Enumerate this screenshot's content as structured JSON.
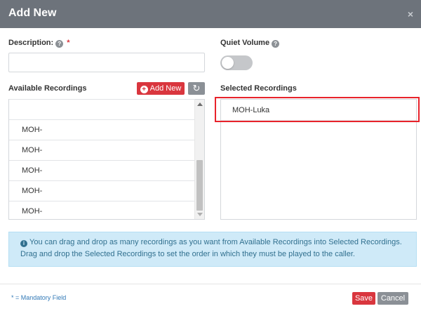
{
  "modal": {
    "title": "Add New",
    "close_glyph": "×"
  },
  "form": {
    "description_label": "Description:",
    "description_value": "",
    "quiet_volume_label": "Quiet Volume",
    "quiet_volume_on": false,
    "required_marker": "*",
    "help_glyph": "?"
  },
  "available": {
    "label": "Available Recordings",
    "add_new_label": "Add New",
    "refresh_glyph": "↻",
    "items": [
      "",
      "MOH-",
      "MOH-",
      "MOH-",
      "MOH-",
      "MOH-"
    ]
  },
  "selected": {
    "label": "Selected Recordings",
    "items": [
      "MOH-Luka"
    ]
  },
  "info": {
    "icon_glyph": "i",
    "text": "You can drag and drop as many recordings as you want from Available Recordings into Selected Recordings. Drag and drop the Selected Recordings to set the order in which they must be played to the caller."
  },
  "footer": {
    "mandatory_note": "* = Mandatory Field",
    "save_label": "Save",
    "cancel_label": "Cancel"
  },
  "colors": {
    "header": "#6d737b",
    "primary": "#d9363e",
    "secondary": "#8b9096",
    "info_bg": "#cfeaf8",
    "highlight": "#e8232b"
  },
  "icons": {
    "close": "close-icon",
    "help": "question-circle-icon",
    "plus": "plus-circle-icon",
    "refresh": "refresh-icon",
    "info": "info-circle-icon"
  }
}
